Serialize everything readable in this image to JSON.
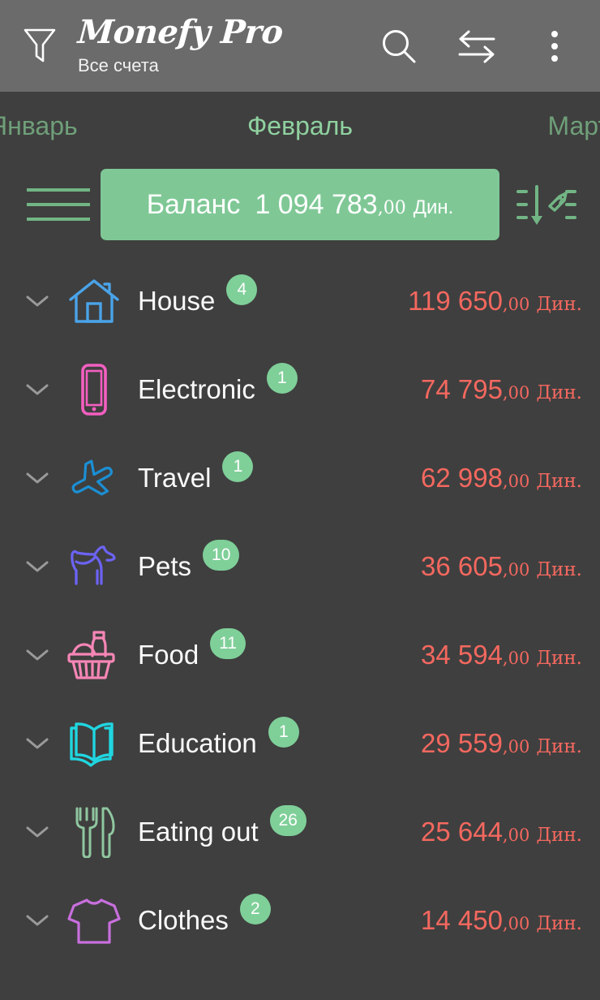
{
  "header": {
    "filter_icon": "filter-funnel-icon",
    "brand_title": "Monefy Pro",
    "brand_subtitle": "Все счета",
    "search_icon": "search-icon",
    "transfer_icon": "transfer-arrows-icon",
    "overflow_icon": "more-vertical-icon"
  },
  "months": {
    "previous": "Январь",
    "current": "Февраль",
    "next": "Март"
  },
  "balance": {
    "menu_icon": "hamburger-menu-icon",
    "label": "Баланс",
    "integer": "1 094 783",
    "decimal": ",00",
    "currency": "Дин.",
    "sort_icon": "sort-by-amount-descending-icon",
    "pill_color": "#7fc896"
  },
  "colors": {
    "background": "#3f3f3f",
    "appbar": "#6b6b6b",
    "accent_green": "#7fc896",
    "badge_green": "#7fcf99",
    "expense_red": "#f4685f",
    "month_active": "#8fd1a0",
    "month_inactive": "#6f9f79"
  },
  "categories": [
    {
      "name": "House",
      "count": "4",
      "icon": "house-icon",
      "icon_color": "#4aa3e8",
      "amount_integer": "119 650",
      "amount_decimal": ",00",
      "currency": "Дин.",
      "chevron": "chevron-down-icon"
    },
    {
      "name": "Electronic",
      "count": "1",
      "icon": "smartphone-icon",
      "icon_color": "#f45fc0",
      "amount_integer": "74 795",
      "amount_decimal": ",00",
      "currency": "Дин.",
      "chevron": "chevron-down-icon"
    },
    {
      "name": "Travel",
      "count": "1",
      "icon": "airplane-icon",
      "icon_color": "#1b8fd4",
      "amount_integer": "62 998",
      "amount_decimal": ",00",
      "currency": "Дин.",
      "chevron": "chevron-down-icon"
    },
    {
      "name": "Pets",
      "count": "10",
      "icon": "dog-icon",
      "icon_color": "#6c63f5",
      "amount_integer": "36 605",
      "amount_decimal": ",00",
      "currency": "Дин.",
      "chevron": "chevron-down-icon"
    },
    {
      "name": "Food",
      "count": "11",
      "icon": "grocery-basket-icon",
      "icon_color": "#f786b6",
      "amount_integer": "34 594",
      "amount_decimal": ",00",
      "currency": "Дин.",
      "chevron": "chevron-down-icon"
    },
    {
      "name": "Education",
      "count": "1",
      "icon": "open-book-icon",
      "icon_color": "#20d6e0",
      "amount_integer": "29 559",
      "amount_decimal": ",00",
      "currency": "Дин.",
      "chevron": "chevron-down-icon"
    },
    {
      "name": "Eating out",
      "count": "26",
      "icon": "fork-knife-icon",
      "icon_color": "#8fc7a0",
      "amount_integer": "25 644",
      "amount_decimal": ",00",
      "currency": "Дин.",
      "chevron": "chevron-down-icon"
    },
    {
      "name": "Clothes",
      "count": "2",
      "icon": "tshirt-icon",
      "icon_color": "#c86fdd",
      "amount_integer": "14 450",
      "amount_decimal": ",00",
      "currency": "Дин.",
      "chevron": "chevron-down-icon"
    }
  ]
}
